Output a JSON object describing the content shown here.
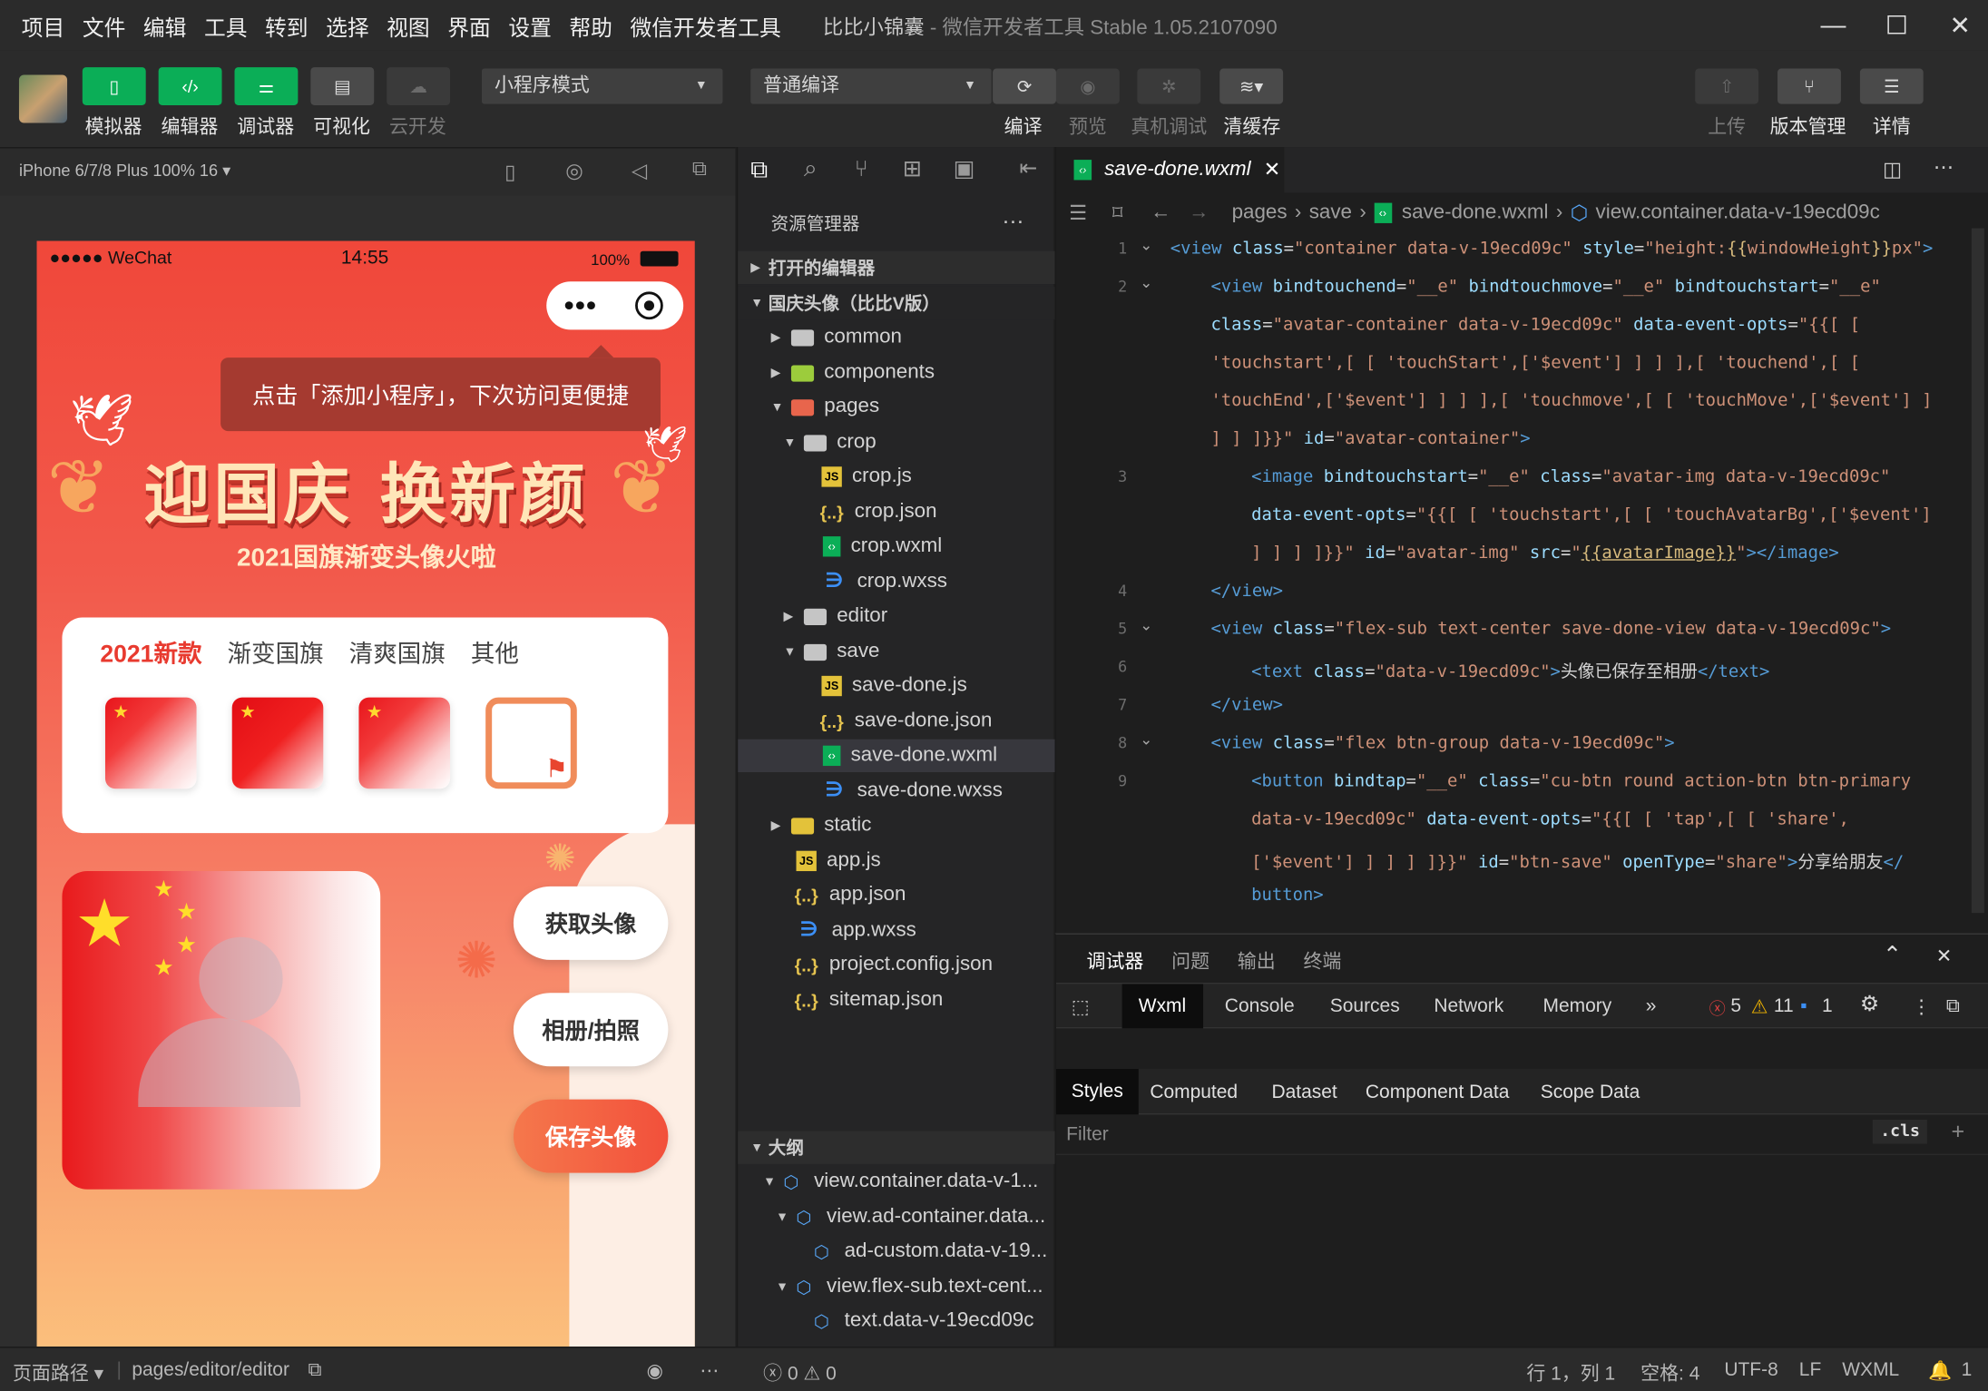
{
  "menu": [
    "项目",
    "文件",
    "编辑",
    "工具",
    "转到",
    "选择",
    "视图",
    "界面",
    "设置",
    "帮助",
    "微信开发者工具"
  ],
  "window": {
    "title": "比比小锦囊",
    "subtitle": "- 微信开发者工具 Stable 1.05.2107090"
  },
  "toolbar": {
    "simulator": "模拟器",
    "editor": "编辑器",
    "debugger": "调试器",
    "visual": "可视化",
    "cloud": "云开发",
    "mode_select": "小程序模式",
    "compile_select": "普通编译",
    "compile": "编译",
    "preview": "预览",
    "real_debug": "真机调试",
    "clear_cache": "清缓存",
    "upload": "上传",
    "version": "版本管理",
    "details": "详情"
  },
  "device": {
    "label": "iPhone 6/7/8 Plus 100% 16 ▾"
  },
  "phone": {
    "carrier": "●●●●● WeChat",
    "time": "14:55",
    "battery": "100%",
    "tooltip": "点击「添加小程序」，下次访问更便捷",
    "banner_title": "迎国庆 换新颜",
    "banner_sub": "2021国旗渐变头像火啦",
    "tabs": [
      "2021新款",
      "渐变国旗",
      "清爽国旗",
      "其他"
    ],
    "btn_get": "获取头像",
    "btn_album": "相册/拍照",
    "btn_save": "保存头像"
  },
  "explorer": {
    "header": "资源管理器",
    "open_editors": "打开的编辑器",
    "project": "国庆头像（比比V版）",
    "items": [
      {
        "label": "common",
        "type": "folder"
      },
      {
        "label": "components",
        "type": "folder"
      },
      {
        "label": "pages",
        "type": "folder"
      },
      {
        "label": "crop",
        "type": "folder"
      },
      {
        "label": "crop.js",
        "type": "js"
      },
      {
        "label": "crop.json",
        "type": "json"
      },
      {
        "label": "crop.wxml",
        "type": "wxml"
      },
      {
        "label": "crop.wxss",
        "type": "wxss"
      },
      {
        "label": "editor",
        "type": "folder"
      },
      {
        "label": "save",
        "type": "folder"
      },
      {
        "label": "save-done.js",
        "type": "js"
      },
      {
        "label": "save-done.json",
        "type": "json"
      },
      {
        "label": "save-done.wxml",
        "type": "wxml"
      },
      {
        "label": "save-done.wxss",
        "type": "wxss"
      },
      {
        "label": "static",
        "type": "folder"
      },
      {
        "label": "app.js",
        "type": "js"
      },
      {
        "label": "app.json",
        "type": "json"
      },
      {
        "label": "app.wxss",
        "type": "wxss"
      },
      {
        "label": "project.config.json",
        "type": "json"
      },
      {
        "label": "sitemap.json",
        "type": "json"
      }
    ],
    "outline": "大纲",
    "outline_items": [
      "view.container.data-v-1...",
      "view.ad-container.data...",
      "ad-custom.data-v-19...",
      "view.flex-sub.text-cent...",
      "text.data-v-19ecd09c"
    ]
  },
  "editor": {
    "tab": "save-done.wxml",
    "breadcrumb": [
      "pages",
      "save",
      "save-done.wxml",
      "view.container.data-v-19ecd09c"
    ]
  },
  "debugger": {
    "panel_tabs": [
      "调试器",
      "问题",
      "输出",
      "终端"
    ],
    "dev_tabs": [
      "Wxml",
      "Console",
      "Sources",
      "Network",
      "Memory"
    ],
    "errors": "5",
    "warnings": "11",
    "infos": "1",
    "style_tabs": [
      "Styles",
      "Computed",
      "Dataset",
      "Component Data",
      "Scope Data"
    ],
    "filter_placeholder": "Filter",
    "cls": ".cls"
  },
  "status": {
    "page_path_label": "页面路径 ▾",
    "page_path": "pages/editor/editor",
    "problems": "ⓧ 0 ⚠ 0",
    "cursor": "行 1，列 1",
    "spaces": "空格: 4",
    "encoding": "UTF-8",
    "eol": "LF",
    "language": "WXML",
    "notifications": "1"
  },
  "colors": {
    "accent_green": "#0bae57",
    "phone_red": "#f0473a"
  }
}
